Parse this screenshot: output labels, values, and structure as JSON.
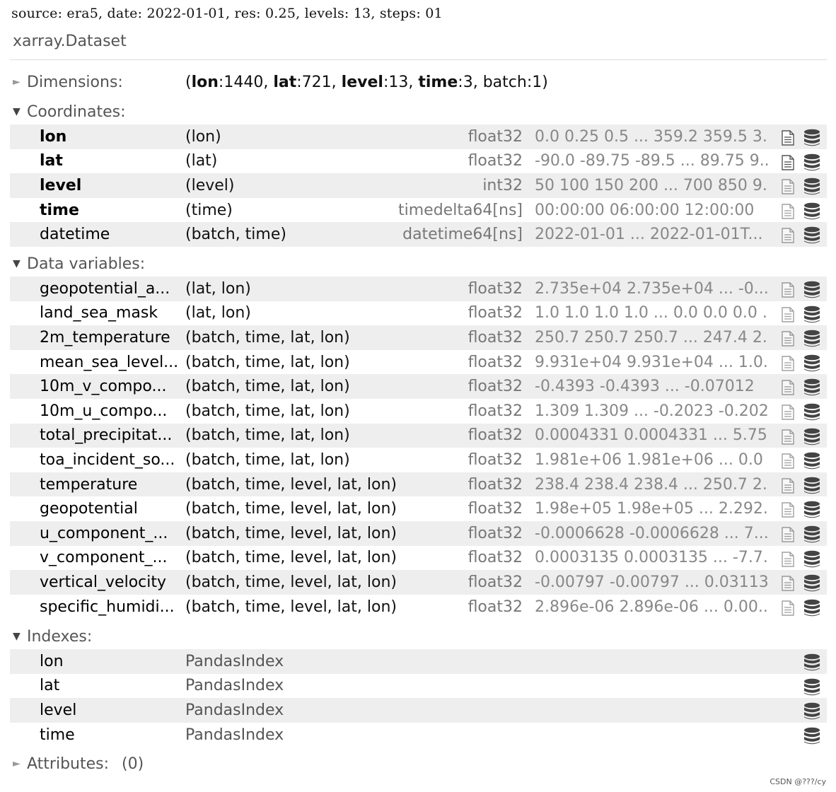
{
  "header": {
    "source_line": "source: era5, date: 2022-01-01, res: 0.25, levels: 13, steps: 01",
    "object_type": "xarray.Dataset"
  },
  "dimensions": {
    "label": "Dimensions:",
    "open_paren": "(",
    "close_paren": ")",
    "items": [
      {
        "name": "lon",
        "value": "1440",
        "bold": true
      },
      {
        "name": "lat",
        "value": "721",
        "bold": true
      },
      {
        "name": "level",
        "value": "13",
        "bold": true
      },
      {
        "name": "time",
        "value": "3",
        "bold": true
      },
      {
        "name": "batch",
        "value": "1",
        "bold": false
      }
    ]
  },
  "coordinates": {
    "label": "Coordinates:",
    "rows": [
      {
        "name": "lon",
        "dims": "(lon)",
        "dtype": "float32",
        "preview": "0.0 0.25 0.5 ... 359.2 359.5 3...",
        "bold": true
      },
      {
        "name": "lat",
        "dims": "(lat)",
        "dtype": "float32",
        "preview": "-90.0 -89.75 -89.5 ... 89.75 9...",
        "bold": true
      },
      {
        "name": "level",
        "dims": "(level)",
        "dtype": "int32",
        "preview": "50 100 150 200 ... 700 850 9...",
        "bold": true
      },
      {
        "name": "time",
        "dims": "(time)",
        "dtype": "timedelta64[ns]",
        "preview": "00:00:00 06:00:00 12:00:00",
        "bold": true
      },
      {
        "name": "datetime",
        "dims": "(batch, time)",
        "dtype": "datetime64[ns]",
        "preview": "2022-01-01 ... 2022-01-01T...",
        "bold": false
      }
    ]
  },
  "data_variables": {
    "label": "Data variables:",
    "rows": [
      {
        "name": "geopotential_a...",
        "dims": "(lat, lon)",
        "dtype": "float32",
        "preview": "2.735e+04 2.735e+04 ... -0...."
      },
      {
        "name": "land_sea_mask",
        "dims": "(lat, lon)",
        "dtype": "float32",
        "preview": "1.0 1.0 1.0 1.0 ... 0.0 0.0 0.0 ..."
      },
      {
        "name": "2m_temperature",
        "dims": "(batch, time, lat, lon)",
        "dtype": "float32",
        "preview": "250.7 250.7 250.7 ... 247.4 2..."
      },
      {
        "name": "mean_sea_level...",
        "dims": "(batch, time, lat, lon)",
        "dtype": "float32",
        "preview": "9.931e+04 9.931e+04 ... 1.0..."
      },
      {
        "name": "10m_v_compo...",
        "dims": "(batch, time, lat, lon)",
        "dtype": "float32",
        "preview": "-0.4393 -0.4393 ... -0.07012"
      },
      {
        "name": "10m_u_compo...",
        "dims": "(batch, time, lat, lon)",
        "dtype": "float32",
        "preview": "1.309 1.309 ... -0.2023 -0.2023"
      },
      {
        "name": "total_precipitat...",
        "dims": "(batch, time, lat, lon)",
        "dtype": "float32",
        "preview": "0.0004331 0.0004331 ... 5.75..."
      },
      {
        "name": "toa_incident_so...",
        "dims": "(batch, time, lat, lon)",
        "dtype": "float32",
        "preview": "1.981e+06 1.981e+06 ... 0.0 ..."
      },
      {
        "name": "temperature",
        "dims": "(batch, time, level, lat, lon)",
        "dtype": "float32",
        "preview": "238.4 238.4 238.4 ... 250.7 2..."
      },
      {
        "name": "geopotential",
        "dims": "(batch, time, level, lat, lon)",
        "dtype": "float32",
        "preview": "1.98e+05 1.98e+05 ... 2.292..."
      },
      {
        "name": "u_component_...",
        "dims": "(batch, time, level, lat, lon)",
        "dtype": "float32",
        "preview": "-0.0006628 -0.0006628 ... 7...."
      },
      {
        "name": "v_component_...",
        "dims": "(batch, time, level, lat, lon)",
        "dtype": "float32",
        "preview": "0.0003135 0.0003135 ... -7.7..."
      },
      {
        "name": "vertical_velocity",
        "dims": "(batch, time, level, lat, lon)",
        "dtype": "float32",
        "preview": "-0.00797 -0.00797 ... 0.03113"
      },
      {
        "name": "specific_humidi...",
        "dims": "(batch, time, level, lat, lon)",
        "dtype": "float32",
        "preview": "2.896e-06 2.896e-06 ... 0.00..."
      }
    ]
  },
  "indexes": {
    "label": "Indexes:",
    "rows": [
      {
        "name": "lon",
        "type": "PandasIndex"
      },
      {
        "name": "lat",
        "type": "PandasIndex"
      },
      {
        "name": "level",
        "type": "PandasIndex"
      },
      {
        "name": "time",
        "type": "PandasIndex"
      }
    ]
  },
  "attributes": {
    "label": "Attributes:",
    "count": "(0)"
  },
  "watermark": "CSDN @???/cy",
  "icons": {
    "expand_arrow": "triangle-down",
    "collapsed_arrow": "triangle-right",
    "attrs_icon": "document-icon",
    "data_icon": "database-icon"
  },
  "colors": {
    "row_shade": "#eeeeee",
    "label_gray": "#555555",
    "dtype_gray": "#777777",
    "preview_gray": "#888888",
    "icon_dark": "#444444"
  }
}
